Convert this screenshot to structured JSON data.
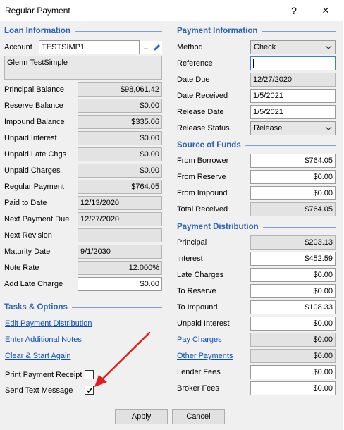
{
  "window": {
    "title": "Regular Payment",
    "help_icon": "?",
    "close_icon": "×"
  },
  "loan_info": {
    "header": "Loan Information",
    "account_label": "Account",
    "account_value": "TESTSIMP1",
    "browse_label": "..",
    "borrower_name": "Glenn TestSimple",
    "fields": [
      {
        "label": "Principal Balance",
        "value": "$98,061.42"
      },
      {
        "label": "Reserve Balance",
        "value": "$0.00"
      },
      {
        "label": "Impound Balance",
        "value": "$335.06"
      },
      {
        "label": "Unpaid Interest",
        "value": "$0.00"
      },
      {
        "label": "Unpaid Late Chgs",
        "value": "$0.00"
      },
      {
        "label": "Unpaid Charges",
        "value": "$0.00"
      },
      {
        "label": "Regular Payment",
        "value": "$764.05"
      },
      {
        "label": "Paid to Date",
        "value": "12/13/2020"
      },
      {
        "label": "Next Payment Due",
        "value": "12/27/2020"
      },
      {
        "label": "Next Revision",
        "value": ""
      },
      {
        "label": "Maturity Date",
        "value": "9/1/2030"
      },
      {
        "label": "Note Rate",
        "value": "12.000%"
      },
      {
        "label": "Add Late Charge",
        "value": "$0.00"
      }
    ]
  },
  "tasks": {
    "header": "Tasks & Options",
    "links": [
      "Edit Payment Distribution",
      "Enter Additional Notes",
      "Clear & Start Again"
    ],
    "print_receipt_label": "Print Payment Receipt",
    "print_receipt_checked": false,
    "send_text_label": "Send Text Message",
    "send_text_checked": true
  },
  "payment_info": {
    "header": "Payment Information",
    "method_label": "Method",
    "method_value": "Check",
    "reference_label": "Reference",
    "reference_value": "",
    "date_due_label": "Date Due",
    "date_due_value": "12/27/2020",
    "date_received_label": "Date Received",
    "date_received_value": "1/5/2021",
    "release_date_label": "Release Date",
    "release_date_value": "1/5/2021",
    "release_status_label": "Release Status",
    "release_status_value": "Release"
  },
  "source_of_funds": {
    "header": "Source of Funds",
    "fields": [
      {
        "label": "From Borrower",
        "value": "$764.05"
      },
      {
        "label": "From Reserve",
        "value": "$0.00"
      },
      {
        "label": "From Impound",
        "value": "$0.00"
      },
      {
        "label": "Total Received",
        "value": "$764.05"
      }
    ]
  },
  "distribution": {
    "header": "Payment Distribution",
    "fields": [
      {
        "label": "Principal",
        "value": "$203.13"
      },
      {
        "label": "Interest",
        "value": "$452.59"
      },
      {
        "label": "Late Charges",
        "value": "$0.00"
      },
      {
        "label": "To Reserve",
        "value": "$0.00"
      },
      {
        "label": "To Impound",
        "value": "$108.33"
      },
      {
        "label": "Unpaid Interest",
        "value": "$0.00"
      },
      {
        "label": "Pay Charges",
        "value": "$0.00"
      },
      {
        "label": "Other Payments",
        "value": "$0.00"
      },
      {
        "label": "Lender Fees",
        "value": "$0.00"
      },
      {
        "label": "Broker Fees",
        "value": "$0.00"
      }
    ]
  },
  "footer": {
    "apply_label": "Apply",
    "cancel_label": "Cancel"
  },
  "colors": {
    "section_header": "#2b63b6",
    "link": "#0b4fc6",
    "annotation_arrow": "#e02020"
  }
}
